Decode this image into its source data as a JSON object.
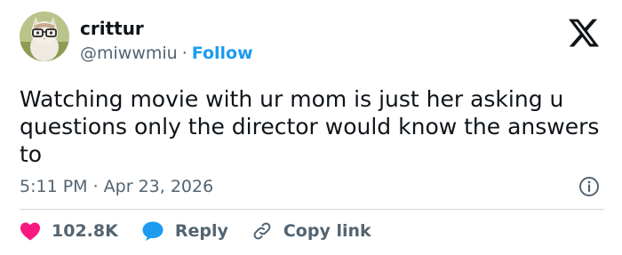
{
  "user": {
    "name": "crittur",
    "handle": "@miwwmiu",
    "separator": "·",
    "follow_label": "Follow"
  },
  "tweet": {
    "text": "Watching movie with ur mom is just her asking u questions only the director would know the answers to",
    "timestamp": "5:11 PM · Apr 23, 2026"
  },
  "actions": {
    "likes_count": "102.8K",
    "reply_label": "Reply",
    "copy_link_label": "Copy link"
  },
  "icons": {
    "brand": "x-logo-icon",
    "info": "info-icon",
    "like": "heart-icon",
    "reply": "speech-bubble-icon",
    "copy": "link-icon"
  },
  "colors": {
    "text": "#0f1419",
    "secondary": "#536471",
    "accent": "#1d9bf0",
    "like": "#f91880",
    "divider": "#cfd9de"
  }
}
